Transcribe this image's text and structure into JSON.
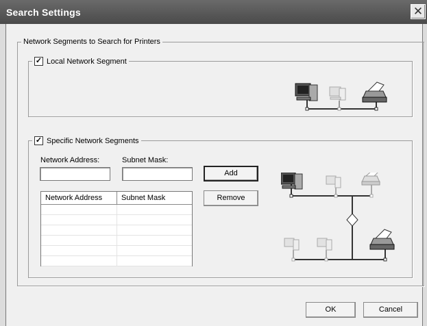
{
  "window": {
    "title": "Search Settings",
    "close_glyph": "✕"
  },
  "outer_group": {
    "legend": "Network Segments to Search for Printers"
  },
  "local_group": {
    "label": "Local Network Segment",
    "checked": true
  },
  "specific_group": {
    "label": "Specific Network Segments",
    "checked": true,
    "network_address_label": "Network Address:",
    "subnet_mask_label": "Subnet Mask:",
    "network_address_value": "",
    "subnet_mask_value": "",
    "add_label": "Add",
    "remove_label": "Remove",
    "table": {
      "columns": [
        "Network Address",
        "Subnet Mask"
      ],
      "rows": []
    }
  },
  "footer": {
    "ok_label": "OK",
    "cancel_label": "Cancel"
  },
  "icons": [
    "computer-icon",
    "printer-icon"
  ]
}
